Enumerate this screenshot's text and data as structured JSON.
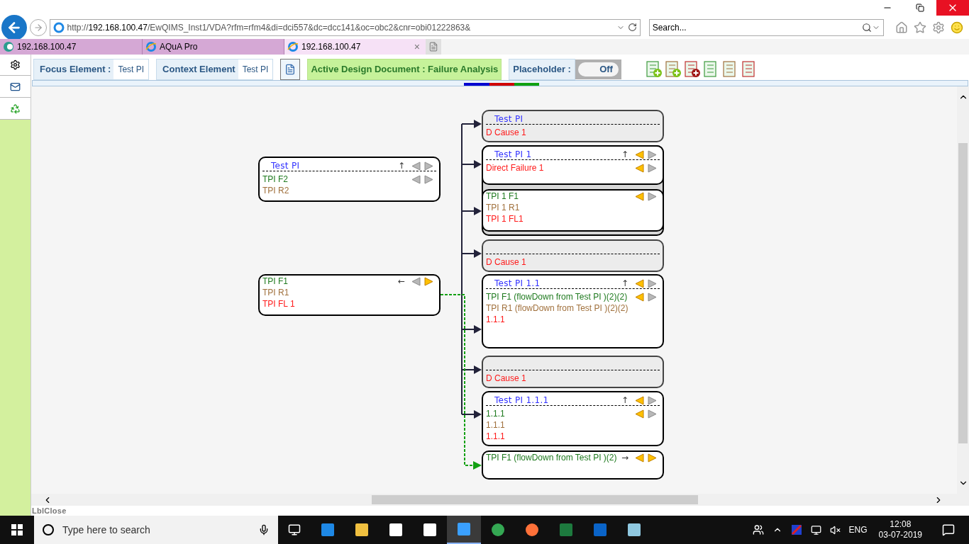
{
  "browser": {
    "address": "http://192.168.100.47/EwQIMS_Inst1/VDA?rfm=rfm4&di=dci557&dc=dcc141&oc=obc2&cnr=obi01222863&",
    "search_placeholder": "Search...",
    "tabs": [
      {
        "label": "192.168.100.47",
        "selected": false
      },
      {
        "label": "AQuA Pro",
        "selected": false
      },
      {
        "label": "192.168.100.47",
        "selected": true,
        "close": "×"
      }
    ]
  },
  "toolbar": {
    "focus_label": "Focus Element :",
    "focus_value": "Test PI",
    "context_label": "Context Element",
    "context_value": "Test PI",
    "active_document": "Active Design Document : Failure Analysis",
    "placeholder_label": "Placeholder :",
    "placeholder_toggle": {
      "label": "Off",
      "on": false
    }
  },
  "diagram": {
    "left_nodes": [
      {
        "kind": "element",
        "title": "Test PI",
        "nav": {
          "arrow": "↑",
          "prev": false,
          "next": false
        },
        "rows": [
          {
            "text": "TPI F2",
            "kind": "function",
            "nav": {
              "prev": false,
              "next": false
            }
          },
          {
            "text": "TPI R2",
            "kind": "requirement"
          }
        ]
      },
      {
        "kind": "element",
        "rows": [
          {
            "text": "TPI F1",
            "kind": "function",
            "nav": {
              "arrow": "←",
              "prev": false,
              "next": true
            }
          },
          {
            "text": "TPI R1",
            "kind": "requirement"
          },
          {
            "text": "TPI FL 1",
            "kind": "failure"
          }
        ]
      }
    ],
    "right_nodes": [
      {
        "kind": "cause",
        "title": "Test PI",
        "rows": [
          {
            "text": "D Cause 1",
            "kind": "failure"
          }
        ]
      },
      {
        "kind": "group",
        "children": [
          {
            "kind": "element",
            "title": "Test PI 1",
            "nav": {
              "arrow": "↑",
              "prev": true,
              "next": false
            },
            "rows": [
              {
                "text": "Direct Failure 1",
                "kind": "failure",
                "nav": {
                  "prev": true,
                  "next": false
                }
              }
            ]
          },
          {
            "kind": "element",
            "rows": [
              {
                "text": "TPI 1 F1",
                "kind": "function",
                "nav": {
                  "prev": true,
                  "next": false
                }
              },
              {
                "text": "TPI 1 R1",
                "kind": "requirement"
              },
              {
                "text": "TPI 1 FL1",
                "kind": "failure"
              }
            ]
          }
        ]
      },
      {
        "kind": "cause",
        "rows": [
          {
            "text": "D Cause 1",
            "kind": "failure"
          }
        ]
      },
      {
        "kind": "element",
        "title": "Test PI 1.1",
        "nav": {
          "arrow": "↑",
          "prev": true,
          "next": false
        },
        "rows": [
          {
            "text": "TPI F1 (flowDown from Test PI )(2)(2)",
            "kind": "function",
            "nav": {
              "prev": true,
              "next": false
            }
          },
          {
            "text": "TPI R1 (flowDown from Test PI )(2)(2)",
            "kind": "requirement"
          },
          {
            "text": "1.1.1",
            "kind": "failure"
          }
        ]
      },
      {
        "kind": "cause",
        "rows": [
          {
            "text": "D Cause 1",
            "kind": "failure"
          }
        ]
      },
      {
        "kind": "element",
        "title": "Test PI 1.1.1",
        "nav": {
          "arrow": "↑",
          "prev": true,
          "next": false
        },
        "rows": [
          {
            "text": "1.1.1",
            "kind": "function",
            "nav": {
              "prev": true,
              "next": false
            }
          },
          {
            "text": "1.1.1",
            "kind": "requirement"
          },
          {
            "text": "1.1.1",
            "kind": "failure"
          }
        ]
      },
      {
        "kind": "element",
        "rows": [
          {
            "text": "TPI F1 (flowDown from Test PI )(2)",
            "kind": "function",
            "nav": {
              "arrow": "→",
              "prev": true,
              "next": true
            }
          }
        ]
      }
    ]
  },
  "footer_label": "LblClose",
  "taskbar": {
    "search_placeholder": "Type here to search",
    "language": "ENG",
    "time": "12:08",
    "date": "03-07-2019"
  }
}
